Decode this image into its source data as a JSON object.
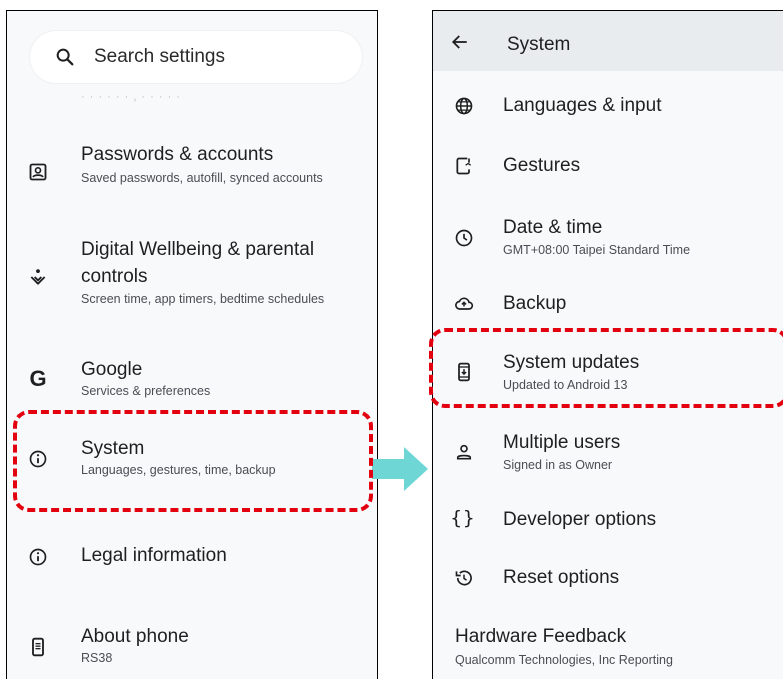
{
  "left": {
    "search_placeholder": "Search settings",
    "faded_text": "· ·   ·   · ·   ·   ,      ·   ·   ·   · ·",
    "items": [
      {
        "title": "Passwords & accounts",
        "subtitle": "Saved passwords, autofill, synced accounts",
        "icon": "account-box-icon"
      },
      {
        "title": "Digital Wellbeing & parental controls",
        "subtitle": "Screen time, app timers, bedtime schedules",
        "icon": "wellbeing-icon"
      },
      {
        "title": "Google",
        "subtitle": "Services & preferences",
        "icon": "google-icon"
      },
      {
        "title": "System",
        "subtitle": "Languages, gestures, time, backup",
        "icon": "info-icon"
      },
      {
        "title": "Legal information",
        "subtitle": "",
        "icon": "info-icon"
      },
      {
        "title": "About phone",
        "subtitle": "RS38",
        "icon": "phone-icon"
      }
    ]
  },
  "right": {
    "appbar_title": "System",
    "items": [
      {
        "title": "Languages & input",
        "subtitle": "",
        "icon": "globe-icon"
      },
      {
        "title": "Gestures",
        "subtitle": "",
        "icon": "gesture-phone-icon"
      },
      {
        "title": "Date & time",
        "subtitle": "GMT+08:00 Taipei Standard Time",
        "icon": "clock-icon"
      },
      {
        "title": "Backup",
        "subtitle": "",
        "icon": "cloud-upload-icon"
      },
      {
        "title": "System updates",
        "subtitle": "Updated to Android 13",
        "icon": "system-update-icon"
      },
      {
        "title": "Multiple users",
        "subtitle": "Signed in as Owner",
        "icon": "person-icon"
      },
      {
        "title": "Developer options",
        "subtitle": "",
        "icon": "braces-icon"
      },
      {
        "title": "Reset options",
        "subtitle": "",
        "icon": "history-icon"
      },
      {
        "title": "Hardware Feedback",
        "subtitle": "Qualcomm Technologies, Inc Reporting",
        "icon": ""
      }
    ]
  },
  "colors": {
    "highlight": "#e3000f",
    "arrow": "#6fd6d6",
    "screen_bg": "#f7f9fb",
    "appbar_bg": "#e9ecef"
  }
}
